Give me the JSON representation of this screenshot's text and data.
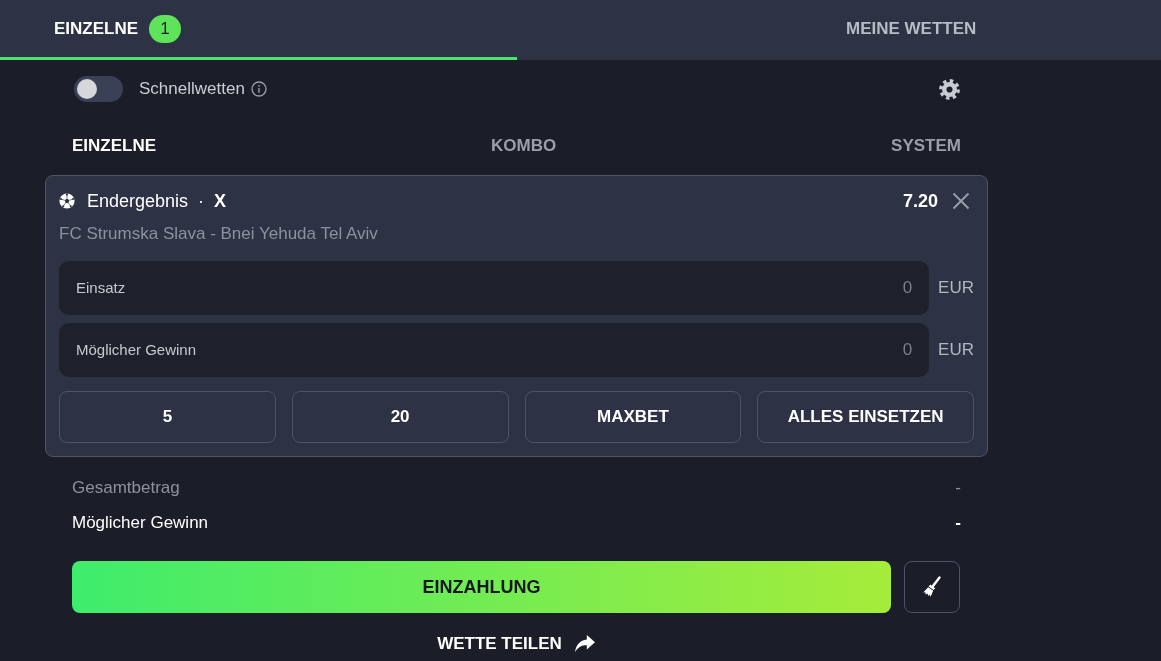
{
  "top_tabs": [
    {
      "label": "EINZELNE",
      "badge": "1",
      "selected": true
    },
    {
      "label": "MEINE WETTEN",
      "selected": false
    }
  ],
  "quick_bet": {
    "label": "Schnellwetten",
    "on": false
  },
  "bet_type_tabs": [
    {
      "label": "EINZELNE",
      "selected": true
    },
    {
      "label": "KOMBO",
      "selected": false
    },
    {
      "label": "SYSTEM",
      "selected": false
    }
  ],
  "bet_slip": {
    "market": "Endergebnis",
    "separator": "·",
    "selection": "X",
    "odds": "7.20",
    "match": "FC Strumska Slava - Bnei Yehuda Tel Aviv",
    "fields": [
      {
        "label": "Einsatz",
        "placeholder": "0",
        "currency": "EUR"
      },
      {
        "label": "Möglicher Gewinn",
        "placeholder": "0",
        "currency": "EUR"
      }
    ],
    "quick_stakes": [
      "5",
      "20",
      "MAXBET",
      "ALLES EINSETZEN"
    ]
  },
  "summary": [
    {
      "kind": "muted",
      "label": "Gesamtbetrag",
      "value": "-"
    },
    {
      "kind": "strong",
      "label": "Möglicher Gewinn",
      "value": "-"
    }
  ],
  "deposit_button": "EINZAHLUNG",
  "share_link": "WETTE TEILEN"
}
